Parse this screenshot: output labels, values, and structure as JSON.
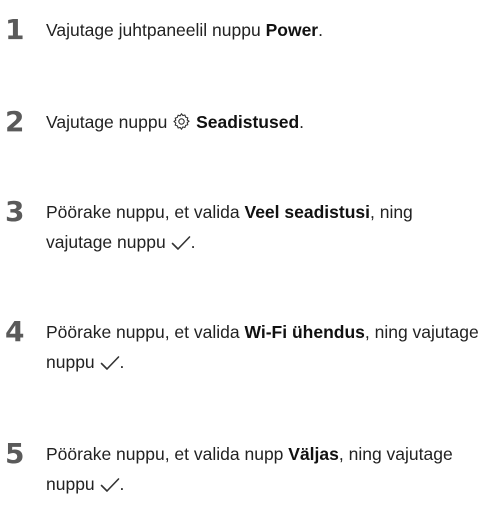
{
  "steps": [
    {
      "number": "1",
      "pre": "Vajutage juhtpaneelil nuppu ",
      "bold": "Power",
      "post": "."
    },
    {
      "number": "2",
      "pre": "Vajutage nuppu ",
      "icon": "gear-icon",
      "bold": "Seadistused",
      "post": "."
    },
    {
      "number": "3",
      "pre": "Pöörake nuppu, et valida ",
      "bold": "Veel seadistusi",
      "mid": ", ning vajutage nuppu ",
      "icon": "checkmark-icon",
      "post": "."
    },
    {
      "number": "4",
      "pre": "Pöörake nuppu, et valida ",
      "bold": "Wi-Fi ühendus",
      "mid": ", ning vajutage nuppu ",
      "icon": "checkmark-icon",
      "post": "."
    },
    {
      "number": "5",
      "pre": "Pöörake nuppu, et valida nupp ",
      "bold": "Väljas",
      "mid": ", ning vajutage nuppu ",
      "icon": "checkmark-icon",
      "post": "."
    }
  ]
}
